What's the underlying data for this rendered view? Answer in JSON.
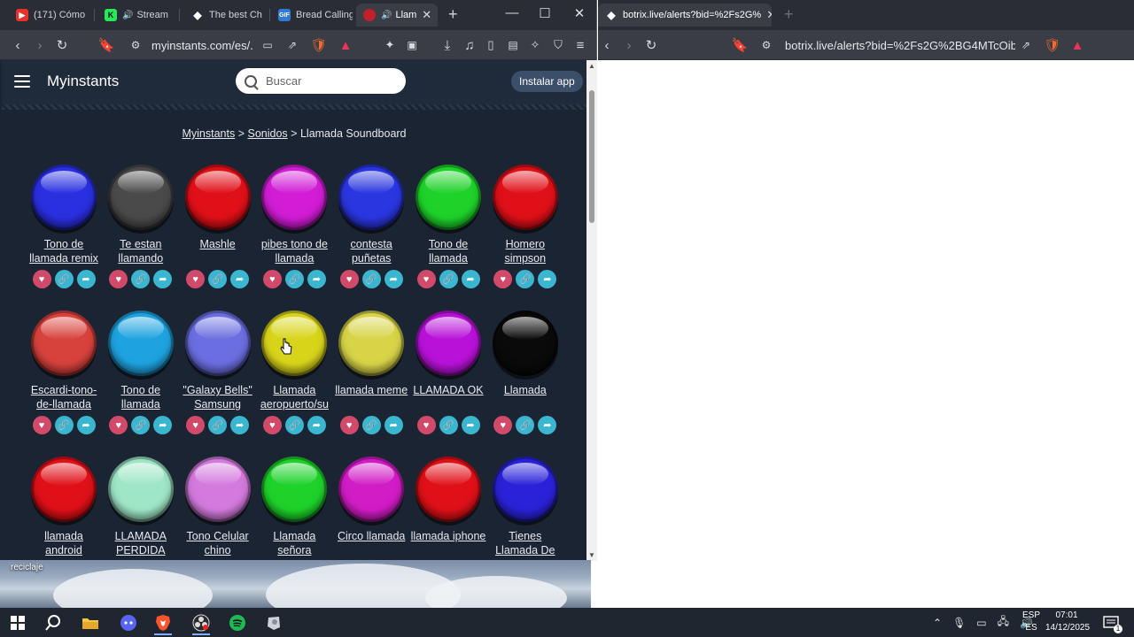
{
  "left_window": {
    "tabs": [
      {
        "title": "(171) Cómo",
        "icon": "youtube-icon",
        "color": "#e8312a"
      },
      {
        "title": "Stream",
        "icon": "kick-icon",
        "color": "#27e85b"
      },
      {
        "title": "The best Ch",
        "icon": "diamond-icon",
        "color": "#ffffff"
      },
      {
        "title": "Bread Calling",
        "icon": "gif-icon",
        "color": "#2f7ad8"
      },
      {
        "title": "Llam",
        "icon": "myinstants-icon",
        "color": "#c0202a"
      }
    ],
    "url": "myinstants.com/es/..."
  },
  "right_window": {
    "tab_title": "botrix.live/alerts?bid=%2Fs2G%",
    "url": "botrix.live/alerts?bid=%2Fs2G%2BG4MTcOibk3i..."
  },
  "site": {
    "logo": "Myinstants",
    "search_placeholder": "Buscar",
    "install_label": "Instalar app",
    "breadcrumb": {
      "home": "Myinstants",
      "sep1": ">",
      "section": "Sonidos",
      "sep2": ">",
      "current": "Llamada Soundboard"
    }
  },
  "buttons": [
    {
      "label": "Tono de llamada remix",
      "color": "#2a2fe0"
    },
    {
      "label": "Te estan llamando",
      "color": "#4a4a4a"
    },
    {
      "label": "Mashle",
      "color": "#e01018"
    },
    {
      "label": "pibes tono de llamada",
      "color": "#d21cd6"
    },
    {
      "label": "contesta puñetas",
      "color": "#2a36e0"
    },
    {
      "label": "Tono de llamada",
      "color": "#1ed22a"
    },
    {
      "label": "Homero simpson",
      "color": "#e01018"
    },
    {
      "label": "Escardi-tono-de-llamada",
      "color": "#d8423c"
    },
    {
      "label": "Tono de llamada",
      "color": "#1ea3e0"
    },
    {
      "label": "\"Galaxy Bells\" Samsung",
      "color": "#6a6ee0"
    },
    {
      "label": "Llamada aeropuerto/su",
      "color": "#d8d41a"
    },
    {
      "label": "llamada meme",
      "color": "#d8d448"
    },
    {
      "label": "LLAMADA OK",
      "color": "#b812d8"
    },
    {
      "label": "Llamada",
      "color": "#0a0a0a"
    },
    {
      "label": "llamada android",
      "color": "#e01018"
    },
    {
      "label": "LLAMADA PERDIDA",
      "color": "#9ee6c6"
    },
    {
      "label": "Tono Celular chino",
      "color": "#d47ade"
    },
    {
      "label": "Llamada señora",
      "color": "#1ed22a"
    },
    {
      "label": "Circo llamada",
      "color": "#d21cc6"
    },
    {
      "label": "llamada iphone",
      "color": "#e01018"
    },
    {
      "label": "Tienes Llamada De",
      "color": "#2a22d8"
    }
  ],
  "desktop": {
    "wallpaper_label": "reciclaje"
  },
  "taskbar": {
    "lang_top": "ESP",
    "lang_bottom": "ES",
    "time": "07:01",
    "date": "14/12/2025",
    "notif_count": "1"
  }
}
